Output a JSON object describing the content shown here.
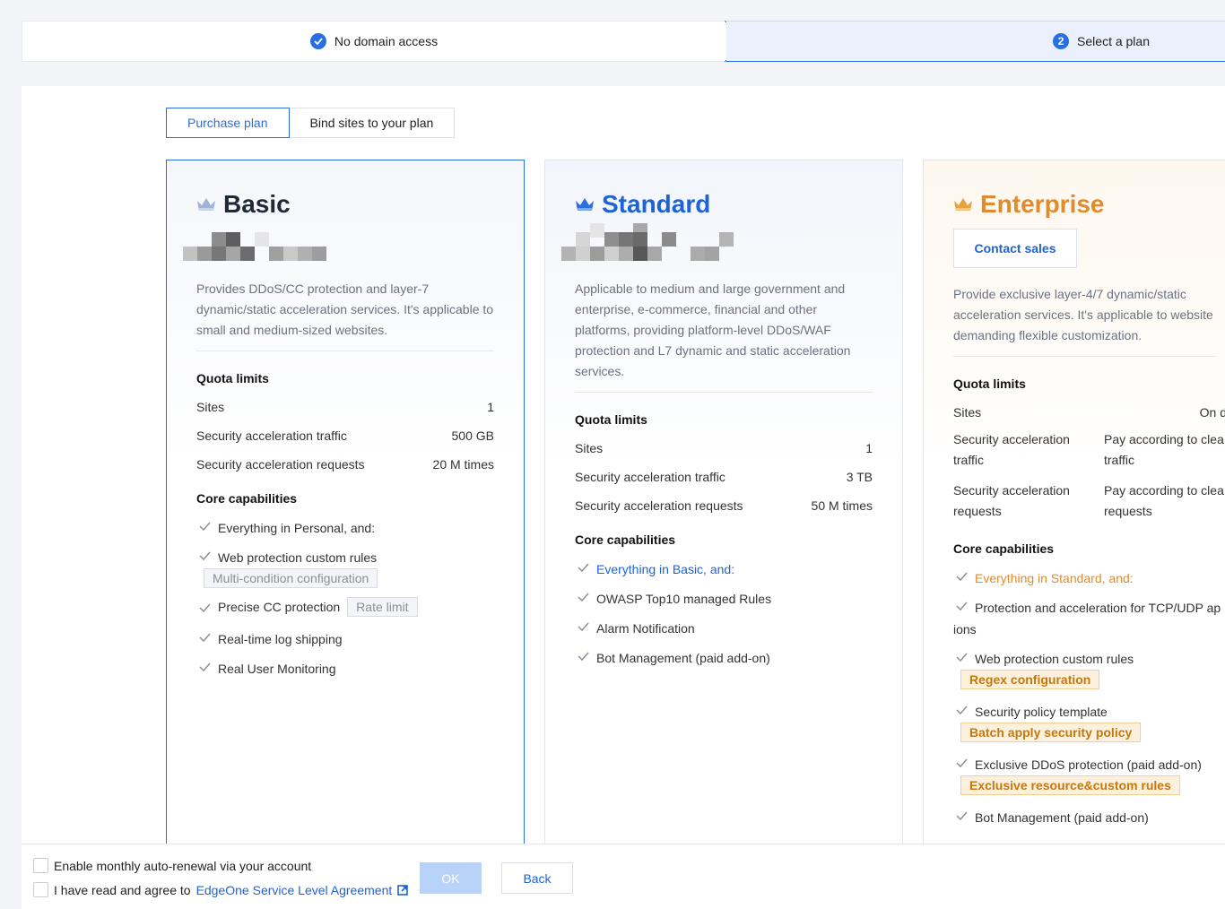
{
  "steps": [
    {
      "label": "No domain access"
    },
    {
      "label": "Select a plan",
      "number": "2"
    }
  ],
  "tabs": [
    {
      "label": "Purchase plan"
    },
    {
      "label": "Bind sites to your plan"
    }
  ],
  "plans": {
    "basic": {
      "title": "Basic",
      "description": "Provides DDoS/CC protection and layer-7 dynamic/static acceleration services. It's applicable to small and medium-sized websites.",
      "quota_title": "Quota limits",
      "quota": [
        {
          "label": "Sites",
          "value": "1"
        },
        {
          "label": "Security acceleration traffic",
          "value": "500 GB"
        },
        {
          "label": "Security acceleration requests",
          "value": "20 M times"
        }
      ],
      "cap_title": "Core capabilities",
      "capabilities": [
        {
          "text": "Everything in Personal, and:"
        },
        {
          "text": "Web protection custom rules",
          "tag": "Multi-condition configuration"
        },
        {
          "text": "Precise CC protection",
          "tag": "Rate limit"
        },
        {
          "text": "Real-time log shipping"
        },
        {
          "text": "Real User Monitoring"
        }
      ]
    },
    "standard": {
      "title": "Standard",
      "description": "Applicable to medium and large government and enterprise, e-commerce, financial and other platforms, providing platform-level DDoS/WAF protection and L7 dynamic and static acceleration services.",
      "quota_title": "Quota limits",
      "quota": [
        {
          "label": "Sites",
          "value": "1"
        },
        {
          "label": "Security acceleration traffic",
          "value": "3 TB"
        },
        {
          "label": "Security acceleration requests",
          "value": "50 M times"
        }
      ],
      "cap_title": "Core capabilities",
      "capabilities": [
        {
          "text": "Everything in Basic, and:"
        },
        {
          "text": "OWASP Top10 managed Rules"
        },
        {
          "text": "Alarm Notification"
        },
        {
          "text": "Bot Management (paid add-on)"
        }
      ]
    },
    "enterprise": {
      "title": "Enterprise",
      "contact_label": "Contact sales",
      "description": "Provide exclusive layer-4/7 dynamic/static acceleration services. It's applicable to website demanding flexible customization.",
      "quota_title": "Quota limits",
      "quota": [
        {
          "label": "Sites",
          "value": "On d"
        },
        {
          "label": "Security acceleration traffic",
          "value": "Pay according to clea traffic"
        },
        {
          "label": "Security acceleration requests",
          "value": "Pay according to clea requests"
        }
      ],
      "cap_title": "Core capabilities",
      "capabilities": [
        {
          "text": "Everything in Standard, and:"
        },
        {
          "text": "Protection and acceleration for TCP/UDP ap",
          "text2": "ions"
        },
        {
          "text": "Web protection custom rules",
          "tag": "Regex configuration"
        },
        {
          "text": "Security policy template",
          "tag": "Batch apply security policy"
        },
        {
          "text": "Exclusive DDoS protection (paid add-on)",
          "tag": "Exclusive resource&custom rules"
        },
        {
          "text": "Bot Management (paid add-on)"
        }
      ]
    }
  },
  "footer": {
    "auto_renew_label": "Enable monthly auto-renewal via your account",
    "agree_prefix": "I have read and agree to",
    "agree_link": "EdgeOne Service Level Agreement",
    "ok_label": "OK",
    "back_label": "Back"
  },
  "colors": {
    "primary": "#2a6fe0",
    "standard_title": "#1e63d6",
    "enterprise_title": "#e08b2d"
  }
}
